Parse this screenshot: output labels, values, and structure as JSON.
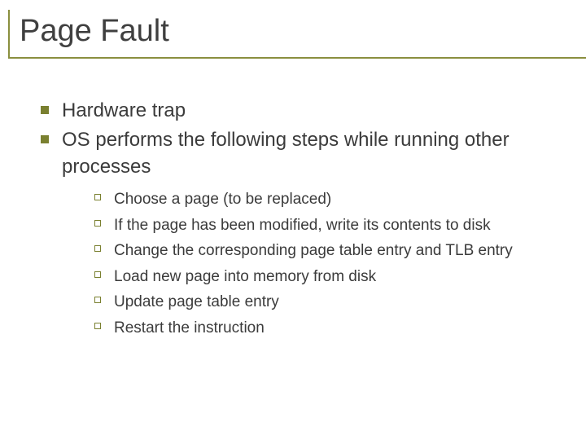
{
  "title": "Page Fault",
  "bullets": [
    {
      "text": "Hardware trap"
    },
    {
      "text": "OS performs the following steps while running other processes"
    }
  ],
  "sub_bullets": [
    {
      "text": "Choose a page (to be replaced)"
    },
    {
      "text": "If the page has been modified, write its contents to disk"
    },
    {
      "text": "Change the corresponding page table entry and TLB entry"
    },
    {
      "text": "Load new page into memory from disk"
    },
    {
      "text": "Update page table entry"
    },
    {
      "text": "Restart the instruction"
    }
  ]
}
